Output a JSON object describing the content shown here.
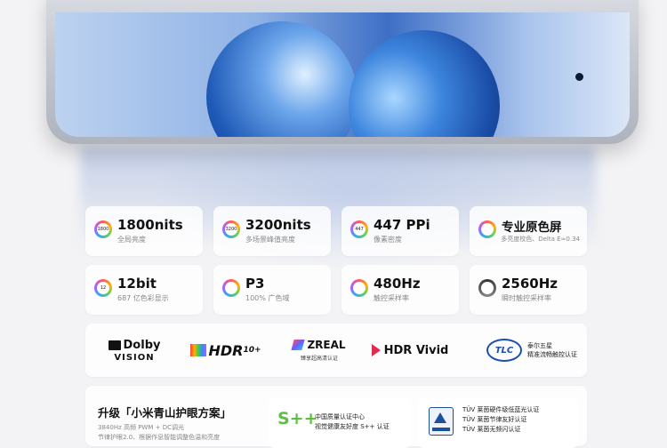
{
  "stats": [
    {
      "big": "1800nits",
      "small": "全局亮度",
      "icon_text": "1800"
    },
    {
      "big": "3200nits",
      "small": "多场景峰值亮度",
      "icon_text": "3200"
    },
    {
      "big": "447 PPi",
      "small": "像素密度",
      "icon_text": "447"
    },
    {
      "big": "专业原色屏",
      "small": "多亮度校色、Delta E≈0.34"
    },
    {
      "big": "12bit",
      "small": "687 亿色彩显示",
      "icon_text": "12"
    },
    {
      "big": "P3",
      "small": "100% 广色域"
    },
    {
      "big": "480Hz",
      "small": "触控采样率"
    },
    {
      "big": "2560Hz",
      "small": "瞬时触控采样率"
    }
  ],
  "logos": {
    "dolby_top": "Dolby",
    "dolby_bottom": "VISION",
    "hdr10_main": "HDR",
    "hdr10_sup": "10+",
    "zreal_main": "ZREAL",
    "zreal_sub": "臻享超高清认证",
    "hdrvivid": "HDR Vivid",
    "tlc_badge": "TLC",
    "tlc_line1": "泰尔五星",
    "tlc_line2": "精准流畅触控认证"
  },
  "eye_care": {
    "title": "升级「小米青山护眼方案」",
    "line1": "3840Hz 高频 PWM + DC调光",
    "line2": "节律护眼2.0、根据作息智能调整色温和亮度",
    "splus_logo": "S++",
    "splus_line1": "中国质量认证中心",
    "splus_line2": "视觉健康友好度 S++ 认证",
    "tuv_line1": "TÜV 莱茵硬件级低蓝光认证",
    "tuv_line2": "TÜV 莱茵节律友好认证",
    "tuv_line3": "TÜV 莱茵无频闪认证"
  }
}
